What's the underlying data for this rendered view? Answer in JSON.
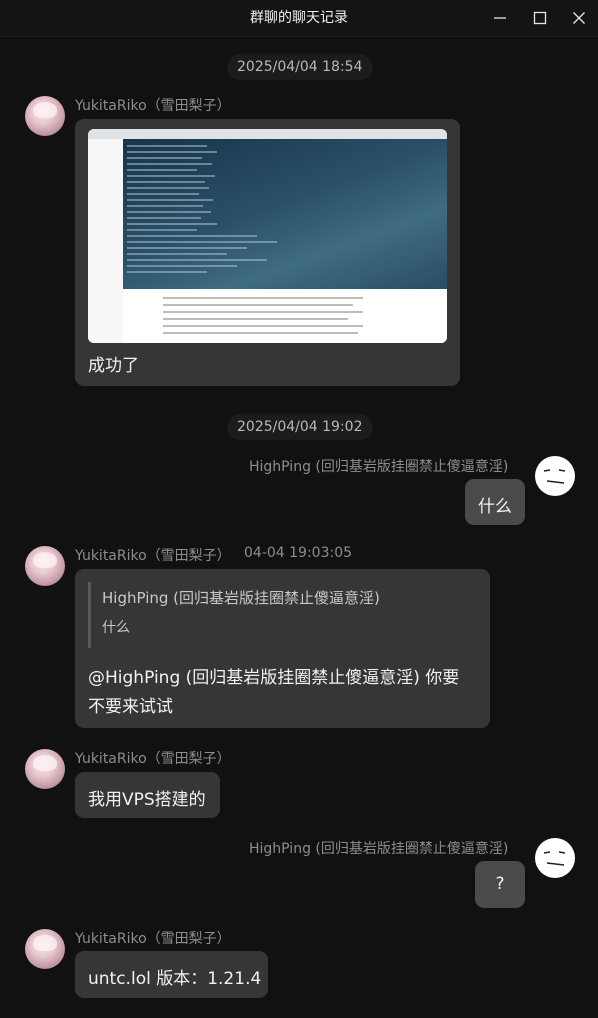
{
  "window": {
    "title": "群聊的聊天记录",
    "minimize_icon": "minimize-icon",
    "maximize_icon": "maximize-icon",
    "close_icon": "close-icon"
  },
  "timestamps": [
    "2025/04/04 18:54",
    "2025/04/04 19:02"
  ],
  "messages": [
    {
      "sender": "YukitaRiko（雪田梨子）",
      "text": "成功了",
      "has_image": true
    },
    {
      "sender": "HighPing (回归基岩版挂圈禁止傻逼意淫)",
      "text": "什么"
    },
    {
      "sender": "YukitaRiko（雪田梨子）",
      "time": "04-04 19:03:05",
      "quote": {
        "sender": "HighPing (回归基岩版挂圈禁止傻逼意淫)",
        "text": "什么"
      },
      "lines": [
        "@HighPing (回归基岩版挂圈禁止傻逼意淫) 你要",
        "不要来试试"
      ]
    },
    {
      "sender": "YukitaRiko（雪田梨子）",
      "text": "我用VPS搭建的"
    },
    {
      "sender": "HighPing (回归基岩版挂圈禁止傻逼意淫)",
      "text": "?"
    },
    {
      "sender": "YukitaRiko（雪田梨子）",
      "text": "untc.lol 版本：1.21.4"
    }
  ]
}
